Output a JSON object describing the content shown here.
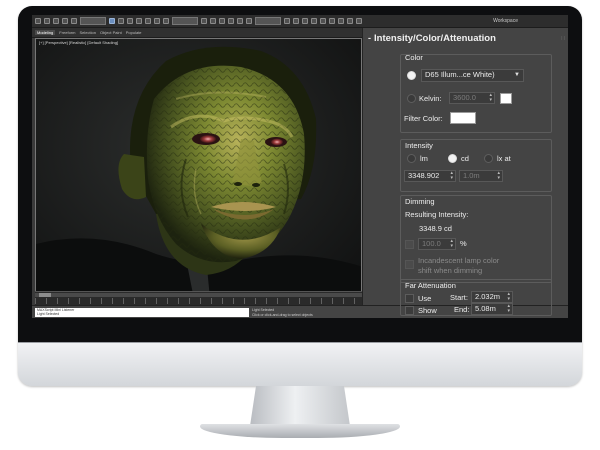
{
  "toolbar": {
    "workspace_label": "Workspace"
  },
  "subtoolbar": {
    "tabs": [
      "Modeling",
      "Freeform",
      "Selection",
      "Object Paint",
      "Populate"
    ]
  },
  "viewport": {
    "label": "[+] [Perspective] [Realistic] [Default Shading]"
  },
  "command_panel": {
    "rollout_toggle": "-",
    "rollout_title": "Intensity/Color/Attenuation",
    "color": {
      "group_title": "Color",
      "preset_value": "D65 Illum...ce White)",
      "kelvin_label": "Kelvin:",
      "kelvin_value": "3600.0",
      "filter_color_label": "Filter Color:"
    },
    "intensity": {
      "group_title": "Intensity",
      "unit_lm": "lm",
      "unit_cd": "cd",
      "unit_lx": "lx at",
      "value": "3348.902",
      "distance": "1.0m"
    },
    "dimming": {
      "group_title": "Dimming",
      "resulting_label": "Resulting Intensity:",
      "resulting_value": "3348.9 cd",
      "percent_value": "100.0",
      "percent_sign": "%",
      "incandescent_line1": "Incandescent lamp color",
      "incandescent_line2": "shift when dimming"
    },
    "far_attenuation": {
      "group_title": "Far Attenuation",
      "use_label": "Use",
      "show_label": "Show",
      "start_label": "Start:",
      "start_value": "2.032m",
      "end_label": "End:",
      "end_value": "5.08m"
    }
  },
  "status": {
    "listener_line1": "MAXScript Mini Listener",
    "listener_line2": "Light Selected",
    "prompt_line1": "Light Selected",
    "prompt_line2": "Click or click-and-drag to select objects"
  },
  "colors": {
    "panel_bg": "#444444",
    "viewport_bg": "#1b1c1c",
    "skin_green": "#6f7a2c",
    "toolbar_highlight": "#6b8fbf"
  }
}
